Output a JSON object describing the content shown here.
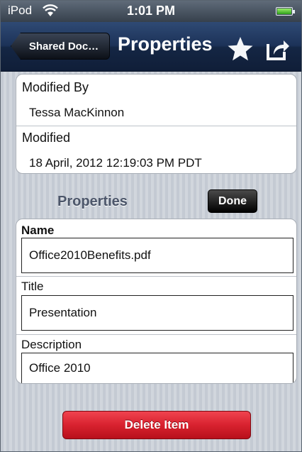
{
  "status_bar": {
    "carrier": "iPod",
    "time": "1:01 PM"
  },
  "nav_bar": {
    "back_label": "Shared Doc…",
    "title": "Properties",
    "star_icon": "star-icon",
    "share_icon": "share-icon"
  },
  "info": {
    "modified_by_label": "Modified By",
    "modified_by_value": "Tessa MacKinnon",
    "modified_label": "Modified",
    "modified_value": "18 April, 2012 12:19:03 PM PDT"
  },
  "properties": {
    "section_title": "Properties",
    "done_label": "Done",
    "name_label": "Name",
    "name_value": "Office2010Benefits.pdf",
    "title_label": "Title",
    "title_value": "Presentation",
    "description_label": "Description",
    "description_value": "Office 2010"
  },
  "actions": {
    "delete_label": "Delete Item"
  },
  "colors": {
    "nav": "#1c3258",
    "delete": "#d8222f",
    "done": "#000000"
  }
}
